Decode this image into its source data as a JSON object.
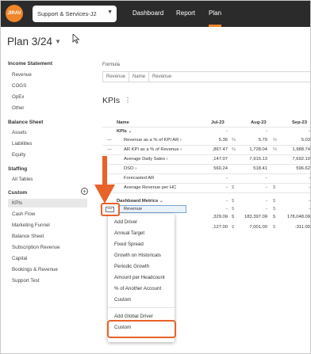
{
  "logo": {
    "text": "JIRAV"
  },
  "workspace": {
    "value": "Support & Services-J2"
  },
  "nav": {
    "dashboard": "Dashboard",
    "report": "Report",
    "plan": "Plan"
  },
  "plan_title": "Plan 3/24",
  "sidebar": {
    "income_statement": {
      "title": "Income Statement",
      "items": [
        "Revenue",
        "COGS",
        "OpEx",
        "Other"
      ]
    },
    "balance_sheet": {
      "title": "Balance Sheet",
      "items": [
        "Assets",
        "Liabilities",
        "Equity"
      ]
    },
    "staffing": {
      "title": "Staffing",
      "items": [
        "All Tables"
      ]
    },
    "custom": {
      "title": "Custom",
      "items": [
        "KPIs",
        "Cash Flow",
        "Marketing Funnel",
        "Balance Sheet",
        "Subscription Revenue",
        "Capital",
        "Bookings & Revenue",
        "Support Test"
      ]
    }
  },
  "formula": {
    "label": "Formula",
    "parts": [
      "Revenue",
      "Name",
      "Revenue"
    ]
  },
  "kpis_heading": "KPIs",
  "table": {
    "headers": {
      "name": "Name",
      "c1": "Jul-23",
      "c2": "Aug-23",
      "c3": "Sep-23"
    },
    "group_kpis": "KPIs",
    "rows": [
      {
        "name": "Revenue as a % of KPI AR",
        "v1": "5.36",
        "p1": "%",
        "v2": "5.79",
        "p2": "%",
        "v3": "5.03"
      },
      {
        "name": "AR KPI as a % of Revenue",
        "v1": ",867.47",
        "p1": "%",
        "v2": "1,728.04",
        "p2": "%",
        "v3": "1,988.74"
      },
      {
        "name": "Average Daily Sales",
        "v1": ",147.07",
        "p1": "",
        "v2": "7,915.13",
        "p2": "",
        "v3": "7,692.10"
      },
      {
        "name": "DSO",
        "v1": "560.24",
        "p1": "",
        "v2": "518.41",
        "p2": "",
        "v3": "596.62"
      },
      {
        "name": "Forecasted AR",
        "v1": "-",
        "p1": "",
        "v2": "-",
        "p2": "",
        "v3": "-"
      },
      {
        "name": "Average Revenue per HC",
        "v1": "-",
        "p1": "$",
        "v2": "-",
        "p2": "$",
        "v3": "-"
      }
    ],
    "group_dashboard": "Dashboard Metrics",
    "revenue_row": {
      "name": "Revenue",
      "v1": "-",
      "p1": "$",
      "v2": "-",
      "p2": "$",
      "v3": "-"
    },
    "extra_rows": [
      {
        "v1": "-",
        "p1": "$",
        "v2": "-",
        "p2": "$",
        "v3": "-"
      },
      {
        "v1": ",329.00",
        "p1": "$",
        "v2": "183,397.00",
        "p2": "$",
        "v3": "178,048.00"
      },
      {
        "v1": ",127.00",
        "p1": "$",
        "v2": "7,001.00",
        "p2": "$",
        "v3": "-311.00"
      }
    ],
    "dash_symbol": "—"
  },
  "menu": {
    "items": [
      "Add Driver",
      "Annual Target",
      "Fixed Spread",
      "Growth on Historicals",
      "Periodic Growth",
      "Amount per Headcount",
      "% of Another Account",
      "Custom"
    ],
    "global_title": "Add Global Driver",
    "global_custom": "Custom"
  },
  "colors": {
    "accent": "#f0852a",
    "annotation": "#e8622a",
    "topbar": "#2b2b2b"
  }
}
